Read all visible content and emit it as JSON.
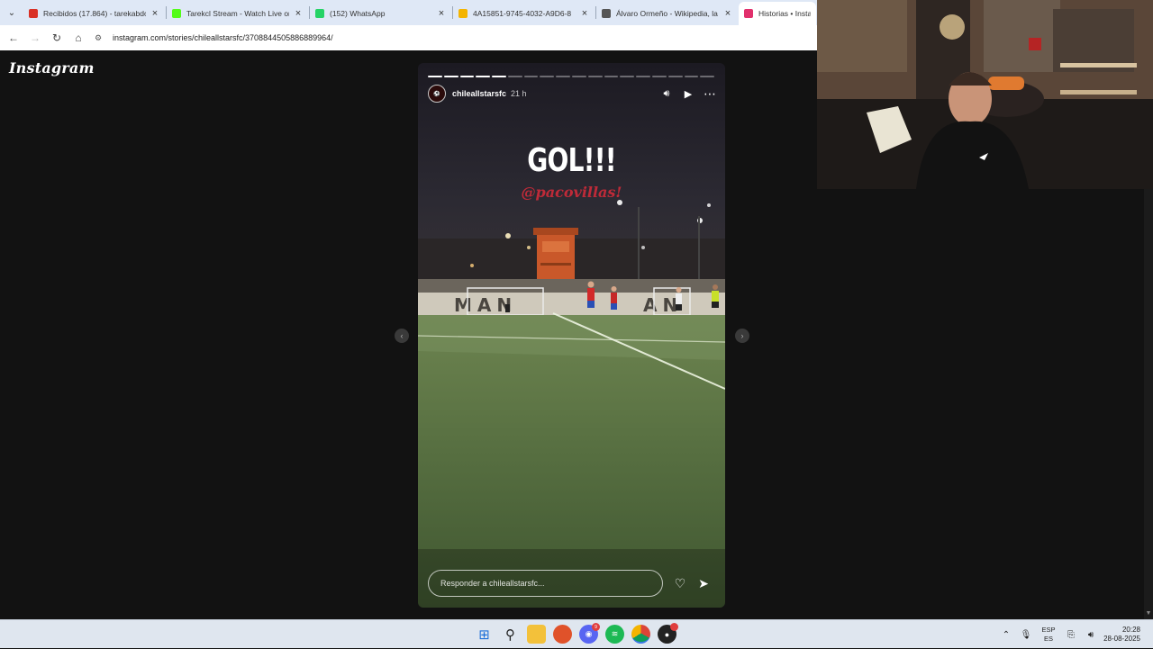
{
  "browser": {
    "tabs": [
      {
        "title": "Recibidos (17.864) - tarekabdo",
        "icon": "gmail-icon",
        "color": "#d93025",
        "active": false
      },
      {
        "title": "Tarekcl Stream - Watch Live on",
        "icon": "kick-icon",
        "color": "#53fc18",
        "active": false
      },
      {
        "title": "(152) WhatsApp",
        "icon": "whatsapp-icon",
        "color": "#25d366",
        "active": false
      },
      {
        "title": "4A15851-9745-4032-A9D6-8",
        "icon": "drive-icon",
        "color": "#f4b400",
        "active": false
      },
      {
        "title": "Álvaro Ormeño - Wikipedia, la",
        "icon": "wikipedia-icon",
        "color": "#555555",
        "active": false
      },
      {
        "title": "Historias • Instagra",
        "icon": "instagram-icon",
        "color": "#e1306c",
        "active": true
      }
    ],
    "url": "instagram.com/stories/chileallstarsfc/3708844505886889964/"
  },
  "page": {
    "logo": "Instagram"
  },
  "story": {
    "username": "chileallstarsfc",
    "time": "21 h",
    "progress": {
      "total": 18,
      "done": 5
    },
    "headline": "GOL!!!",
    "tag": "@pacovillas!",
    "reply_placeholder": "Responder a chileallstarsfc...",
    "colors": {
      "brand": "#d92b3a"
    }
  },
  "taskbar": {
    "lang_top": "ESP",
    "lang_bottom": "ES",
    "time": "20:28",
    "date": "28-08-2025"
  }
}
